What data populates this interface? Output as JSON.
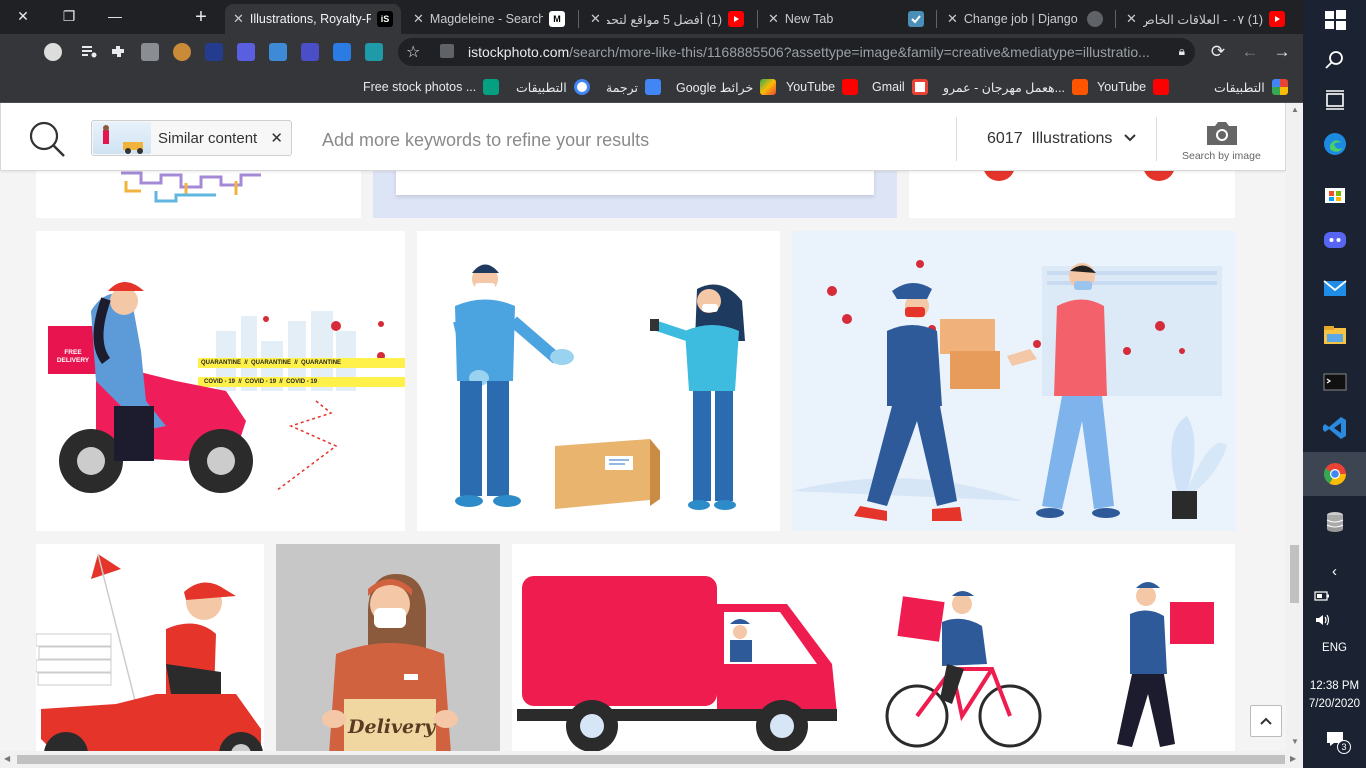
{
  "tabs": [
    {
      "title": "Illustrations, Royalty-F",
      "active": true,
      "favicon": "istock-icon"
    },
    {
      "title": "Magdeleine - Search",
      "active": false,
      "favicon": "magdeleine-icon"
    },
    {
      "title": "(1) أفضل 5 مواقع لتحم",
      "active": false,
      "favicon": "youtube-icon"
    },
    {
      "title": "New Tab",
      "active": false,
      "favicon": "checkmark-icon"
    },
    {
      "title": "Change job | Django",
      "active": false,
      "favicon": "globe-icon"
    },
    {
      "title": "(1) ٠٧ - العلاقات الخاص",
      "active": false,
      "favicon": "youtube-icon"
    }
  ],
  "istock_favicon_text": "iS",
  "omnibox": {
    "host": "istockphoto.com",
    "path": "/search/more-like-this/1168885506?assettype=image&family=creative&mediatype=illustratio..."
  },
  "bookmarks": [
    {
      "label": "التطبيقات",
      "icon": "apps-grid-icon"
    },
    {
      "label": "YouTube",
      "icon": "youtube-icon"
    },
    {
      "label": "هعمل مهرجان - عمرو...",
      "icon": "soundcloud-icon"
    },
    {
      "label": "Gmail",
      "icon": "gmail-icon"
    },
    {
      "label": "YouTube",
      "icon": "youtube-icon"
    },
    {
      "label": "Google خرائط",
      "icon": "maps-icon"
    },
    {
      "label": "ترجمة",
      "icon": "translate-icon"
    },
    {
      "label": "التطبيقات",
      "icon": "google-icon"
    },
    {
      "label": "Free stock photos ...",
      "icon": "pexels-icon"
    }
  ],
  "search": {
    "chip_label": "Similar content",
    "keywords_placeholder": "Add more keywords to refine your results",
    "result_count": "6017",
    "media_type": "Illustrations",
    "search_by_image": "Search by image"
  },
  "illustration_texts": {
    "free_delivery": "FREE DELIVERY",
    "quarantine": "QUARANTINE",
    "covid": "COVID - 19",
    "delivery_box": "Delivery"
  },
  "taskbar": {
    "time": "12:38 PM",
    "date": "7/20/2020",
    "language": "ENG",
    "notifications": "3"
  },
  "colors": {
    "accent_red": "#e8144f",
    "chrome_bg": "#202124",
    "taskbar_bg": "#1b2332"
  }
}
